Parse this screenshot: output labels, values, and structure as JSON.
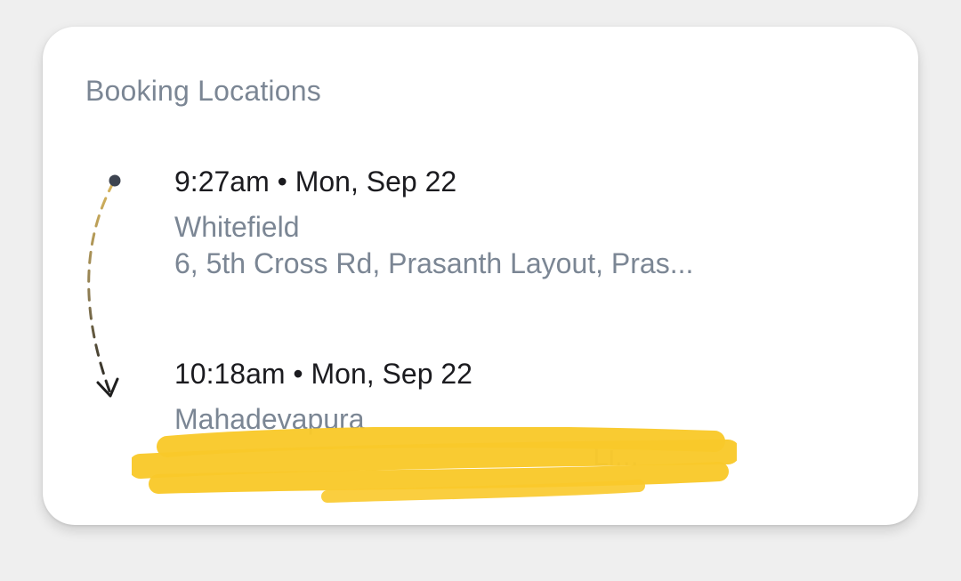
{
  "card": {
    "title": "Booking Locations"
  },
  "route": {
    "stops": [
      {
        "time": "9:27am",
        "separator": "•",
        "date": "Mon, Sep 22",
        "name": "Whitefield",
        "address": "6, 5th Cross Rd, Prasanth Layout, Pras..."
      },
      {
        "time": "10:18am",
        "separator": "•",
        "date": "Mon, Sep 22",
        "name": "Mahadevapura",
        "address": "Li..."
      }
    ]
  },
  "colors": {
    "background": "#efefef",
    "card": "#ffffff",
    "title": "#7b8694",
    "time_text": "#1b1b1f",
    "secondary_text": "#7b8694",
    "route_gold": "#c9a64a",
    "route_dark": "#2a2a2a",
    "redaction": "#f9c92a"
  },
  "icons": {
    "start_marker": "dot-icon",
    "end_marker": "arrow-down-icon"
  }
}
